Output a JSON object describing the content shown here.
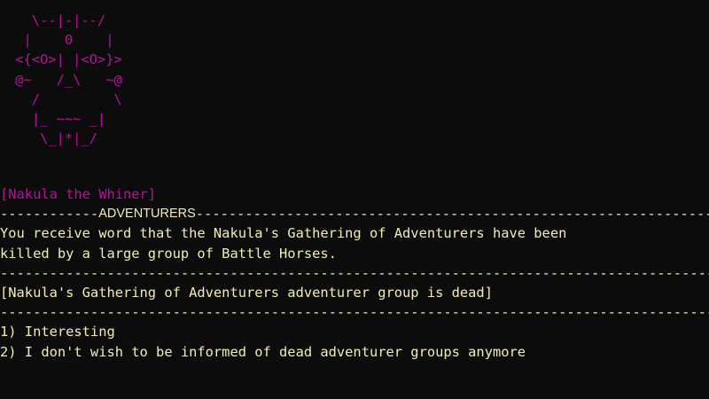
{
  "portrait": {
    "ascii_art": "   \\--|-|--/\n  |    0    |\n <{<O>| |<O>}>\n @~   /_\\   ~@\n   /         \\\n   |_ ~~~ _|\n    \\_|*|_/",
    "color": "#b4149a"
  },
  "speaker": {
    "name": "[Nakula the Whiner]",
    "color": "#b4149a"
  },
  "section": {
    "label": "ADVENTURERS",
    "lead_dashes": "------------",
    "trail_dashes": "------------------------------------------------------------------------------------------------------------------------"
  },
  "message": {
    "line1": "You receive word that the Nakula's Gathering of Adventurers have been",
    "line2": "killed by a large group of Battle Horses."
  },
  "status": {
    "text": "[Nakula's Gathering of Adventurers adventurer group is dead]"
  },
  "rule_text": "--------------------------------------------------------------------------------------------------------------------------------------------",
  "options": [
    {
      "label": "1) Interesting"
    },
    {
      "label": "2) I don't wish to be informed of dead adventurer groups anymore"
    }
  ],
  "colors": {
    "background": "#0c0c0c",
    "text": "#f2ecb8",
    "accent": "#b4149a"
  }
}
